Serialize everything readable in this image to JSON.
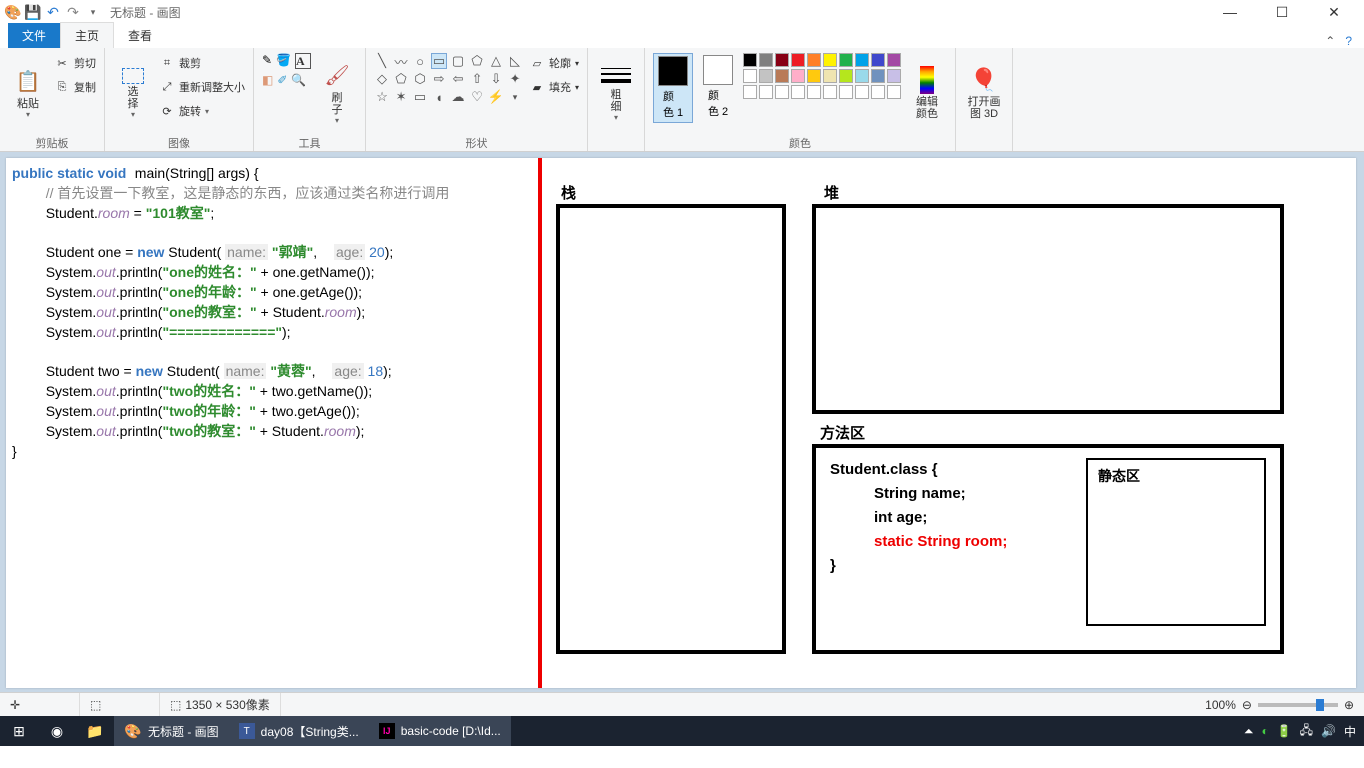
{
  "title": "无标题 - 画图",
  "tabs": {
    "file": "文件",
    "home": "主页",
    "view": "查看"
  },
  "ribbon": {
    "clipboard": {
      "paste": "粘贴",
      "cut": "剪切",
      "copy": "复制",
      "label": "剪贴板"
    },
    "image": {
      "select": "选\n择",
      "crop": "裁剪",
      "resize": "重新调整大小",
      "rotate": "旋转",
      "label": "图像"
    },
    "tools": {
      "brushes": "刷\n子",
      "label": "工具"
    },
    "shapes": {
      "outline": "轮廓",
      "fill": "填充",
      "label": "形状"
    },
    "stroke": {
      "label": "粗\n细"
    },
    "colors": {
      "c1": "颜\n色 1",
      "c2": "颜\n色 2",
      "edit": "编辑\n颜色",
      "label": "颜色",
      "p3d": "打开画\n图 3D"
    }
  },
  "swatches_top": [
    "#000000",
    "#7f7f7f",
    "#880015",
    "#ed1c24",
    "#ff7f27",
    "#fff200",
    "#22b14c",
    "#00a2e8",
    "#3f48cc",
    "#a349a4"
  ],
  "swatches_mid": [
    "#ffffff",
    "#c3c3c3",
    "#b97a57",
    "#ffaec9",
    "#ffc90e",
    "#efe4b0",
    "#b5e61d",
    "#99d9ea",
    "#7092be",
    "#c8bfe7"
  ],
  "code": {
    "d1": "public static void",
    "d2": "main(String[] args) {",
    "c1": "// 首先设置一下教室，这是静态的东西，应该通过类名称进行调用",
    "l1a": "Student.",
    "room": "room",
    "l1b": " = ",
    "s_room": "\"101教室\"",
    "semi": ";",
    "one_decl_a": "Student one = ",
    "kw_new": "new",
    "one_decl_b": " Student( ",
    "p_name": "name:",
    "s_guo": " \"郭靖\"",
    "comma": ",",
    "p_age": "age:",
    "n20": " 20",
    "close_paren": ");",
    "sys": "System.",
    "out": "out",
    "println": ".println(",
    "s_one_name": "\"one的姓名：\"",
    "plus": " + one.getName());",
    "s_one_age": "\"one的年龄：\"",
    "plus_age": " + one.getAge());",
    "s_one_room": "\"one的教室：\"",
    "plus_room": " + Student.",
    "room2": "room",
    "end": ");",
    "s_sep": "\"=============\"",
    "end2": ");",
    "two_decl_a": "Student two = ",
    "two_decl_b": " Student( ",
    "s_huang": " \"黄蓉\"",
    "n18": " 18",
    "s_two_name": "\"two的姓名：\"",
    "plus2n": " + two.getName());",
    "s_two_age": "\"two的年龄：\"",
    "plus2a": " + two.getAge());",
    "s_two_room": "\"two的教室：\"",
    "brace": "}"
  },
  "diagram": {
    "stack": "栈",
    "heap": "堆",
    "method": "方法区",
    "static": "静态区",
    "cls_open": "Student.class {",
    "f1": "String name;",
    "f2": "int age;",
    "f3": "static String room;",
    "cls_close": "}"
  },
  "status": {
    "dims": "1350 × 530像素",
    "zoom": "100%"
  },
  "taskbar": {
    "paint": "无标题 - 画图",
    "notepad": "day08【String类...",
    "idea": "basic-code  [D:\\Id...",
    "ime": "中"
  }
}
